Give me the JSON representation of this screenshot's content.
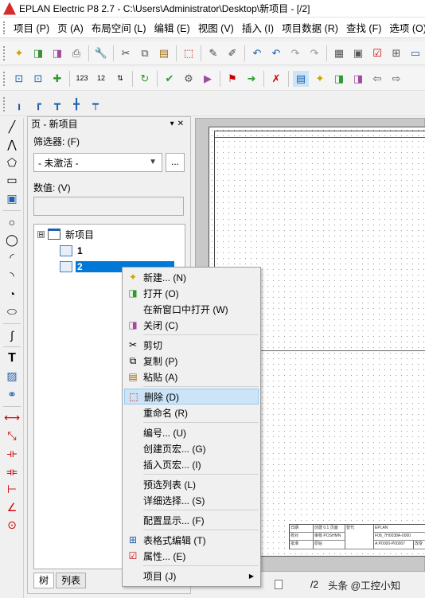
{
  "window": {
    "title": "EPLAN Electric P8 2.7 - C:\\Users\\Administrator\\Desktop\\新项目 - [/2]"
  },
  "menubar": {
    "items": [
      "项目 (P)",
      "页 (A)",
      "布局空间 (L)",
      "编辑 (E)",
      "视图 (V)",
      "插入 (I)",
      "项目数据 (R)",
      "查找 (F)",
      "选项 (O)"
    ]
  },
  "panel": {
    "title": "页 - 新项目",
    "filter_label": "筛选器: (F)",
    "filter_value": "- 未激活 -",
    "filter_more": "...",
    "value_label": "数值: (V)",
    "value_input": "",
    "tree": {
      "root": "新项目",
      "toggle": "⊟",
      "pages": [
        "1",
        "2"
      ]
    },
    "tabs": [
      "树",
      "列表"
    ]
  },
  "status": {
    "page": "/2",
    "watermark": "头条 @工控小知"
  },
  "context_menu": {
    "items": [
      {
        "label": "新建... (N)",
        "icon": "new-page-icon"
      },
      {
        "label": "打开 (O)",
        "icon": "open-page-icon"
      },
      {
        "label": "在新窗口中打开 (W)",
        "icon": ""
      },
      {
        "label": "关闭 (C)",
        "icon": "close-page-icon"
      },
      {
        "label": "剪切",
        "icon": "scissors-icon"
      },
      {
        "label": "复制 (P)",
        "icon": "copy-icon"
      },
      {
        "label": "粘贴 (A)",
        "icon": "paste-icon"
      },
      {
        "label": "删除 (D)",
        "icon": "delete-icon",
        "highlighted": true
      },
      {
        "label": "重命名 (R)",
        "icon": ""
      },
      {
        "label": "编号... (U)",
        "icon": ""
      },
      {
        "label": "创建页宏... (G)",
        "icon": ""
      },
      {
        "label": "插入页宏... (I)",
        "icon": ""
      },
      {
        "label": "预选列表 (L)",
        "icon": ""
      },
      {
        "label": "详细选择... (S)",
        "icon": ""
      },
      {
        "label": "配置显示... (F)",
        "icon": ""
      },
      {
        "label": "表格式编辑 (T)",
        "icon": "table-icon"
      },
      {
        "label": "属性... (E)",
        "icon": "properties-icon"
      },
      {
        "label": "项目 (J)",
        "icon": "",
        "submenu": true
      }
    ]
  },
  "titleblock": {
    "cells": [
      "日期",
      "创建 0.1 页面",
      "校对",
      "审核 POSHMN",
      "批准",
      "原始",
      "替代",
      "EPLAN",
      "F08_7H0038A-0000",
      "A:P0000-P00007",
      "改变"
    ]
  },
  "colors": {
    "selection": "#0078d7",
    "menu_highlight": "#cce4f7",
    "accent_red": "#d62b2b"
  }
}
